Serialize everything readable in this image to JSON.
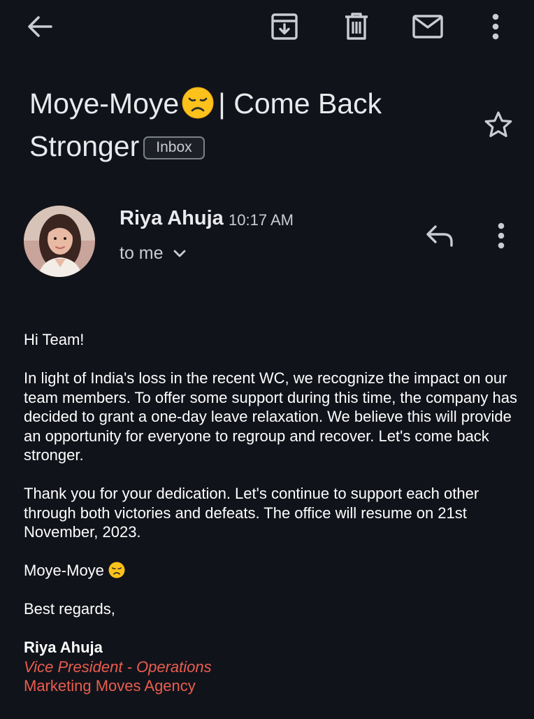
{
  "toolbar": {
    "back_icon": "arrow-left-icon",
    "archive_icon": "archive-icon",
    "delete_icon": "trash-icon",
    "mark_unread_icon": "envelope-icon",
    "more_icon": "more-vert-icon"
  },
  "email": {
    "subject_part1": "Moye-Moye",
    "subject_emoji": "disappointed-face-emoji",
    "subject_part2": "| Come Back Stronger",
    "label": "Inbox",
    "star_icon": "star-outline-icon",
    "sender": {
      "name": "Riya Ahuja",
      "time": "10:17 AM",
      "recipient": "to me"
    },
    "body": {
      "greeting": "Hi Team!",
      "paragraph1": "In light of India's loss in the recent WC, we recognize the impact on our team members. To offer some support during this time, the company has decided to grant a one-day leave relaxation. We believe this will provide an opportunity for everyone to regroup and recover. Let's come back stronger.",
      "paragraph2": "Thank you for your dedication. Let's continue to support each other through both victories and defeats. The office will resume on 21st November, 2023.",
      "sign_phrase": "Moye-Moye",
      "closing": "Best regards,",
      "signature_name": "Riya Ahuja",
      "signature_title": "Vice President - Operations",
      "signature_company": "Marketing Moves Agency"
    }
  },
  "colors": {
    "background": "#11131a",
    "text": "#e8eaed",
    "signature_accent": "#ea5d4f"
  }
}
